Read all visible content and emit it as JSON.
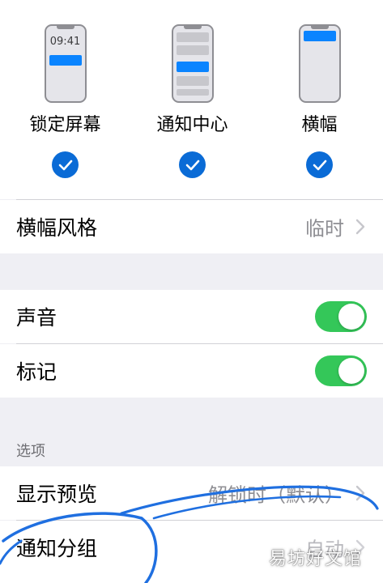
{
  "alert_styles": [
    {
      "label": "锁定屏幕",
      "time": "09:41",
      "selected": true
    },
    {
      "label": "通知中心",
      "selected": true
    },
    {
      "label": "横幅",
      "selected": true
    }
  ],
  "banner_style": {
    "label": "横幅风格",
    "value": "临时"
  },
  "sounds": {
    "label": "声音",
    "on": true
  },
  "badges": {
    "label": "标记",
    "on": true
  },
  "options_section": {
    "header": "选项"
  },
  "show_previews": {
    "label": "显示预览",
    "value": "解锁时（默认）"
  },
  "notification_grouping": {
    "label": "通知分组",
    "value": "自动"
  },
  "watermark": "易坊好文馆",
  "colors": {
    "accent": "#0a84ff",
    "toggle_on": "#34c759",
    "check": "#0a6bd6",
    "scribble": "#1f6fe0"
  }
}
